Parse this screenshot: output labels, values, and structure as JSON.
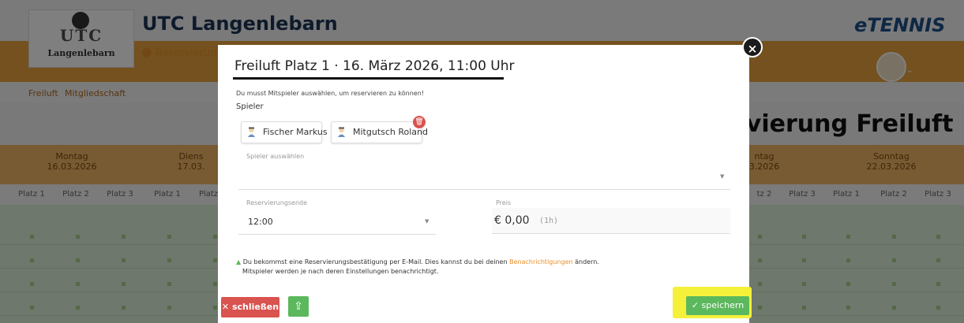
{
  "header": {
    "logo_text": "UTC",
    "logo_subtext": "Langenlebarn",
    "club_title": "UTC Langenlebarn",
    "reservation_link": "Reservierung",
    "brand": "eTENNIS"
  },
  "subnav": {
    "items": [
      "Freiluft",
      "Mitgliedschaft"
    ]
  },
  "banner": {
    "title": "rvierung Freiluft"
  },
  "calendar": {
    "days": [
      {
        "name": "Montag",
        "date": "16.03.2026"
      },
      {
        "name": "Diens",
        "date": "17.03."
      },
      {
        "name": "ntag",
        "date": "3.2026"
      },
      {
        "name": "Sonntag",
        "date": "22.03.2026"
      }
    ],
    "courts_left": [
      "Platz 1",
      "Platz 2",
      "Platz 3",
      "Platz 1",
      "Platz"
    ],
    "courts_right": [
      "tz 2",
      "Platz 3",
      "Platz 1",
      "Platz 2",
      "Platz 3"
    ]
  },
  "modal": {
    "title": "Freiluft Platz 1 · 16. März 2026, 11:00 Uhr",
    "hint": "Du musst Mitspieler auswählen, um reservieren zu können!",
    "players_label": "Spieler",
    "players": [
      "Fischer Markus",
      "Mitgutsch Roland"
    ],
    "select_player_label": "Spieler auswählen",
    "select_player_value": "",
    "end_label": "Reservierungsende",
    "end_value": "12:00",
    "price_label": "Preis",
    "price_value": "€ 0,00",
    "price_duration": "(1h)",
    "notice_line1_prefix": "Du bekommst eine Reservierungsbestätigung per E-Mail. Dies kannst du bei deinen ",
    "notice_link": "Benachrichtigungen",
    "notice_line1_suffix": " ändern.",
    "notice_line2": "Mitspieler werden je nach deren Einstellungen benachrichtigt.",
    "close_label": "schließen",
    "save_label": "speichern"
  },
  "icons": {
    "close_x": "×",
    "close_btn_icon": "✕",
    "share_icon": "⇪",
    "save_check": "✓",
    "trash_icon": "🗑",
    "select_caret": "▼",
    "bell": "▲",
    "avatar_chevron": "⌄"
  },
  "colors": {
    "accent_orange": "#e8902c",
    "danger": "#d9534f",
    "success": "#5cb85c",
    "highlight": "#f5f03a"
  }
}
